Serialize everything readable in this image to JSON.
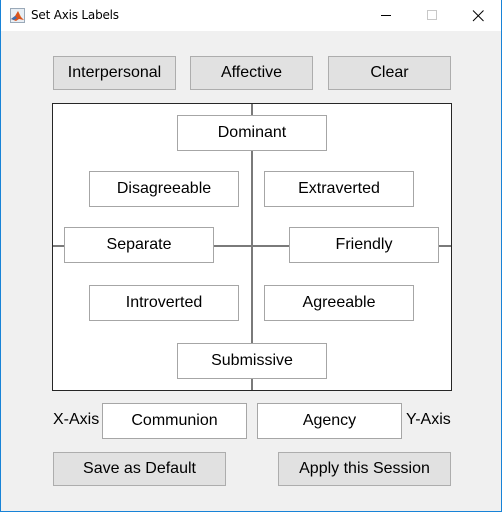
{
  "window": {
    "title": "Set Axis Labels",
    "app_icon": "matlab-icon",
    "controls": {
      "minimize": "minimize-icon",
      "maximize": "maximize-icon",
      "close": "close-icon"
    },
    "border_color": "#1883d7"
  },
  "preset_buttons": {
    "interpersonal": "Interpersonal",
    "affective": "Affective",
    "clear": "Clear"
  },
  "circumplex": {
    "top": "Dominant",
    "upper_left": "Disagreeable",
    "upper_right": "Extraverted",
    "left": "Separate",
    "right": "Friendly",
    "lower_left": "Introverted",
    "lower_right": "Agreeable",
    "bottom": "Submissive"
  },
  "axes": {
    "x_label": "X-Axis",
    "x_value": "Communion",
    "y_value": "Agency",
    "y_label": "Y-Axis"
  },
  "actions": {
    "save_default": "Save as Default",
    "apply_session": "Apply this Session"
  }
}
